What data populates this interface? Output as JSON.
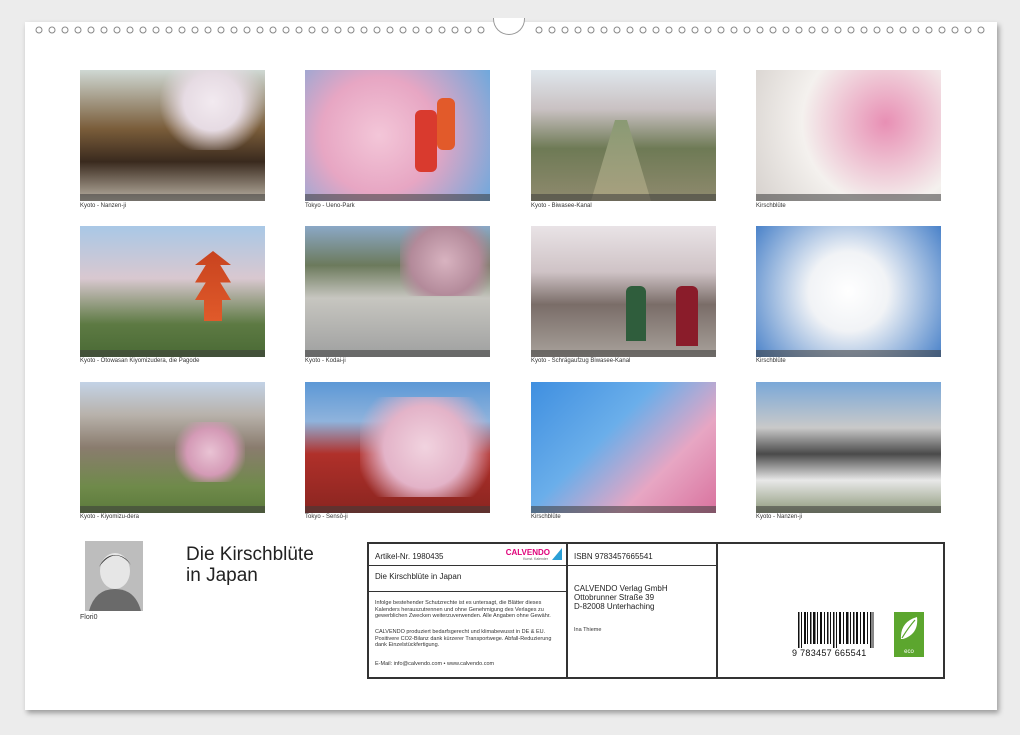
{
  "captions": [
    "Kyoto - Nanzen-ji",
    "Tokyo - Ueno-Park",
    "Kyoto - Biwasee-Kanal",
    "Kirschblüte",
    "Kyoto - Otowasan Kiyomizudera, die Pagode",
    "Kyoto - Kodai-ji",
    "Kyoto - Schrägaufzug Biwasee-Kanal",
    "Kirschblüte",
    "Kyoto - Kiyomizu-dera",
    "Tokyo - Sensō-ji",
    "Kirschblüte",
    "Kyoto - Nanzen-ji"
  ],
  "author": "Flori0",
  "title_line1": "Die Kirschblüte",
  "title_line2": "in Japan",
  "info": {
    "article": "Artikel-Nr. 1980435",
    "logo": "CALVENDO",
    "logo_sub": "Kunst. Kalender",
    "cal_title": "Die Kirschblüte in Japan",
    "legal1": "Infolge bestehender Schutzrechte ist es untersagt, die Blätter dieses Kalenders herauszutrennen und ohne Genehmigung des Verlages zu gewerblichen Zwecken weiterzuverwenden. Alle Angaben ohne Gewähr.",
    "legal2": "CALVENDO produziert bedarfsgerecht und klimabewusst in DE & EU. Positivere CO2-Bilanz dank kürzerer Transportwege. Abfall-Reduzierung dank Einzelstückfertigung.",
    "email": "E-Mail: info@calvendo.com • www.calvendo.com",
    "isbn": "ISBN 9783457665541",
    "publisher1": "CALVENDO Verlag GmbH",
    "publisher2": "Ottobrunner Straße 39",
    "publisher3": "D-82008 Unterhaching",
    "editor": "Ina Thieme",
    "barcode_number": "9   783457   665541",
    "eco_label": "eco"
  },
  "colors": {
    "blossom_pink": "#e7a6c3",
    "sky_blue": "#6fa8dc",
    "calvendo_pink": "#e0007a",
    "eco_green": "#5ca62e"
  }
}
